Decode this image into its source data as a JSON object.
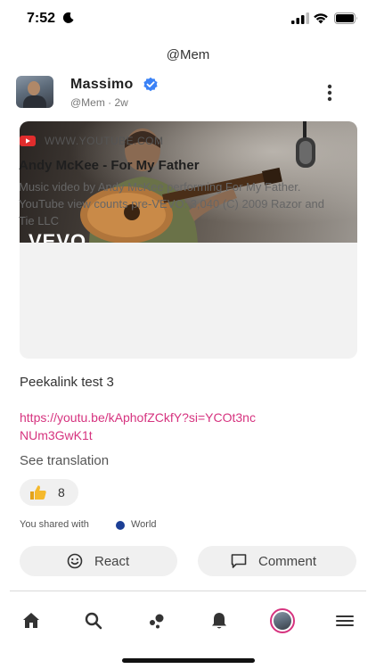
{
  "status_bar": {
    "time": "7:52",
    "moon_icon": "moon-icon",
    "signal_icon": "cellular-signal-icon",
    "wifi_icon": "wifi-icon",
    "battery_icon": "battery-icon"
  },
  "header": {
    "title": "@Mem"
  },
  "post": {
    "author": {
      "name": "Massimo",
      "verified_icon": "verified-badge-icon",
      "handle_time": "@Mem · 2w"
    },
    "more_icon": "vertical-dots-icon",
    "link_preview": {
      "thumbnail_text": "VEVO",
      "source_icon": "youtube-icon",
      "domain": "WWW.YOUTUBE.COM",
      "title": "Andy McKee - For My Father",
      "description": "Music video by Andy McKee performing For My Father. YouTube view counts pre-VEVO: 3,040 (C) 2009 Razor and Tie LLC"
    },
    "text": "Peekalink test 3",
    "link": "https://youtu.be/kAphofZCkfY?si=YCOt3ncNUm3GwK1t",
    "translation_label": "See translation",
    "reactions": {
      "icon": "thumbs-up-icon",
      "count": "8"
    },
    "shared_with": {
      "label": "You shared with",
      "audience": "World",
      "audience_color": "#1c3f95"
    },
    "actions": {
      "react_label": "React",
      "react_icon": "smiley-icon",
      "comment_label": "Comment",
      "comment_icon": "comment-icon"
    }
  },
  "bottom_nav": {
    "items": [
      "home-icon",
      "search-icon",
      "explore-icon",
      "bell-icon",
      "profile-avatar",
      "menu-icon"
    ]
  },
  "colors": {
    "accent": "#d6337f",
    "verified": "#3b82f6",
    "youtube": "#e02d2d"
  }
}
